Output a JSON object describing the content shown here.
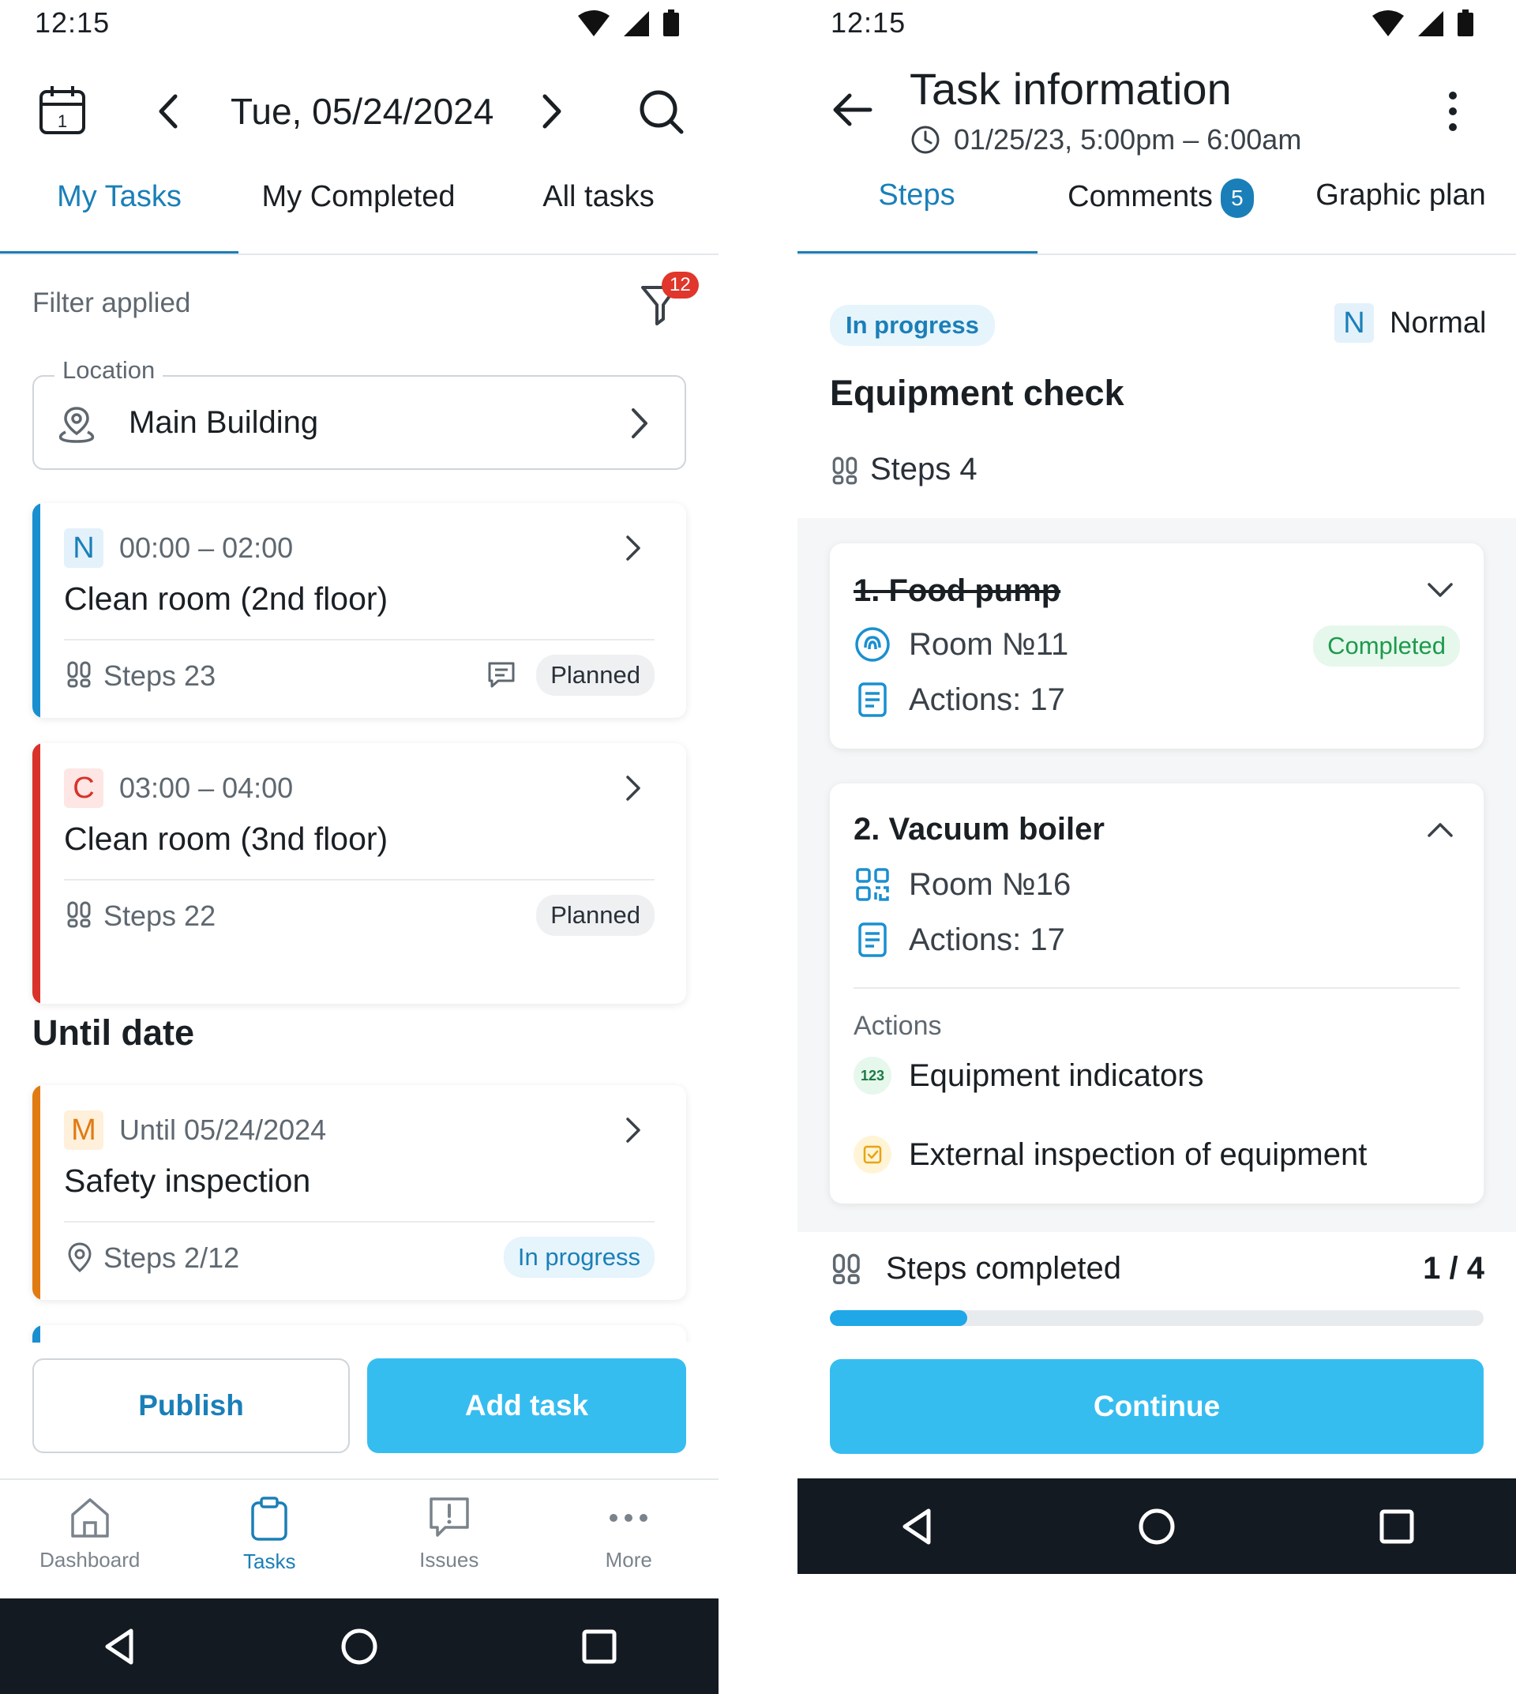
{
  "left": {
    "status_time": "12:15",
    "date": "Tue, 05/24/2024",
    "tabs": [
      {
        "label": "My Tasks",
        "active": true
      },
      {
        "label": "My Completed",
        "active": false
      },
      {
        "label": "All tasks",
        "active": false
      }
    ],
    "filter_text": "Filter applied",
    "filter_count": "12",
    "location": {
      "label": "Location",
      "value": "Main Building"
    },
    "tasks": [
      {
        "priority": "N",
        "time": "00:00 – 02:00",
        "title": "Clean room (2nd floor)",
        "steps": "Steps 23",
        "status": "Planned",
        "stripe": "#1a8fd0"
      },
      {
        "priority": "C",
        "time": "03:00 – 04:00",
        "title": "Clean room (3nd floor)",
        "steps": "Steps 22",
        "status": "Planned",
        "stripe": "#d8322a"
      }
    ],
    "until_section": "Until date",
    "until_task": {
      "priority": "M",
      "time": "Until 05/24/2024",
      "title": "Safety inspection",
      "steps": "Steps 2/12",
      "status": "In progress",
      "stripe": "#e07b12"
    },
    "buttons": {
      "publish": "Publish",
      "add_task": "Add task"
    },
    "nav": [
      {
        "label": "Dashboard",
        "icon": "home-icon"
      },
      {
        "label": "Tasks",
        "icon": "clipboard-icon"
      },
      {
        "label": "Issues",
        "icon": "issue-icon"
      },
      {
        "label": "More",
        "icon": "more-icon"
      }
    ]
  },
  "right": {
    "status_time": "12:15",
    "title": "Task information",
    "datetime": "01/25/23, 5:00pm – 6:00am",
    "tabs": [
      {
        "label": "Steps",
        "active": true
      },
      {
        "label": "Comments",
        "badge": "5",
        "active": false
      },
      {
        "label": "Graphic plan",
        "active": false
      }
    ],
    "status": "In progress",
    "priority_letter": "N",
    "priority_label": "Normal",
    "task_name": "Equipment check",
    "steps_line": "Steps 4",
    "steps": [
      {
        "title": "1. Food pump",
        "room": "Room №11",
        "actions": "Actions: 17",
        "status": "Completed"
      },
      {
        "title": "2. Vacuum boiler",
        "room": "Room №16",
        "actions": "Actions: 17"
      }
    ],
    "actions_heading": "Actions",
    "action_items": [
      {
        "label": "Equipment indicators",
        "icon_text": "123"
      },
      {
        "label": "External inspection of equipment"
      }
    ],
    "steps_completed_label": "Steps completed",
    "steps_completed_value": "1 / 4",
    "progress_fraction": 0.21,
    "continue": "Continue"
  },
  "colors": {
    "accent": "#1a7fb8",
    "primary_button": "#36bdf0",
    "critical": "#d8322a",
    "medium": "#e07b12"
  }
}
